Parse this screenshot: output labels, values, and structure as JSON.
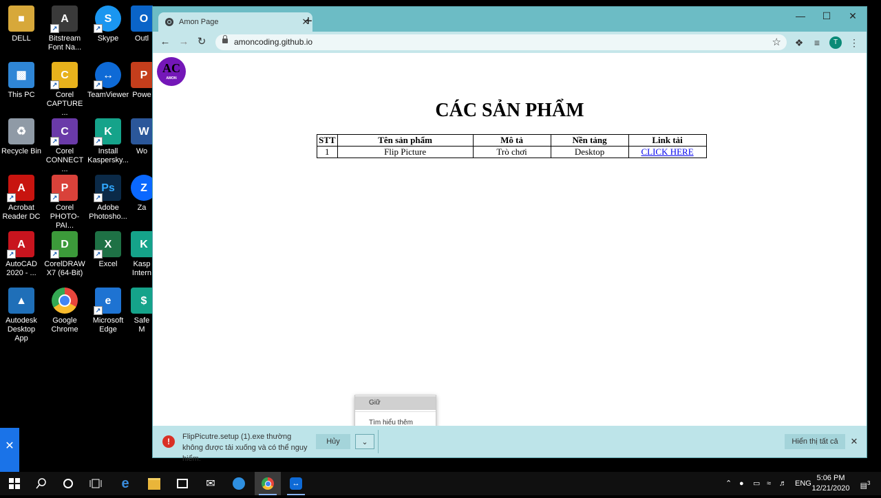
{
  "desktop": {
    "icons": [
      {
        "label": "DELL",
        "icon": "folder-user-icon",
        "color": "#d7a83a"
      },
      {
        "label": "Bitstream Font Na...",
        "icon": "bitstream-icon",
        "color": "#3a3a3a"
      },
      {
        "label": "Skype",
        "icon": "skype-icon",
        "color": "#1a96f0"
      },
      {
        "label": "Outl",
        "icon": "outlook-icon",
        "color": "#0a64c8"
      },
      {
        "label": "This PC",
        "icon": "computer-icon",
        "color": "#2f86d6"
      },
      {
        "label": "Corel CAPTURE ...",
        "icon": "corel-capture-icon",
        "color": "#e8b21c"
      },
      {
        "label": "TeamViewer",
        "icon": "teamviewer-icon",
        "color": "#0e6ad6"
      },
      {
        "label": "Powe",
        "icon": "powerpoint-icon",
        "color": "#c43e1c"
      },
      {
        "label": "Recycle Bin",
        "icon": "recycle-bin-icon",
        "color": "#8f9aa6"
      },
      {
        "label": "Corel CONNECT ...",
        "icon": "corel-connect-icon",
        "color": "#6a3aa8"
      },
      {
        "label": "Install Kaspersky...",
        "icon": "kaspersky-icon",
        "color": "#15a38a"
      },
      {
        "label": "Wo",
        "icon": "word-icon",
        "color": "#2b579a"
      },
      {
        "label": "Acrobat Reader DC",
        "icon": "acrobat-icon",
        "color": "#c8140f"
      },
      {
        "label": "Corel PHOTO-PAI...",
        "icon": "corel-photopaint-icon",
        "color": "#d9423a"
      },
      {
        "label": "Adobe Photosho...",
        "icon": "photoshop-icon",
        "color": "#0b2a48"
      },
      {
        "label": "Za",
        "icon": "zalo-icon",
        "color": "#0a68ff"
      },
      {
        "label": "AutoCAD 2020 - ...",
        "icon": "autocad-icon",
        "color": "#c8141e"
      },
      {
        "label": "CorelDRAW X7 (64-Bit)",
        "icon": "coreldraw-icon",
        "color": "#3c9a3a"
      },
      {
        "label": "Excel",
        "icon": "excel-icon",
        "color": "#1e7145"
      },
      {
        "label": "Kasp Intern",
        "icon": "kaspersky-internet-icon",
        "color": "#15a38a"
      },
      {
        "label": "Autodesk Desktop App",
        "icon": "autodesk-icon",
        "color": "#1f6fb8"
      },
      {
        "label": "Google Chrome",
        "icon": "chrome-icon",
        "color": "#e8453c"
      },
      {
        "label": "Microsoft Edge",
        "icon": "edge-icon",
        "color": "#1e73d2"
      },
      {
        "label": "Safe M",
        "icon": "safe-money-icon",
        "color": "#15a38a"
      }
    ]
  },
  "browser": {
    "tab_title": "Amon Page",
    "url": "amoncoding.github.io",
    "profile_initial": "T",
    "accent": "#6cbcc5"
  },
  "page": {
    "logo_text": "AC",
    "logo_small": "AMON",
    "heading": "CÁC SẢN PHẨM",
    "table": {
      "headers": [
        "STT",
        "Tên sản phẩm",
        "Mô tả",
        "Nền tảng",
        "Link tải"
      ],
      "rows": [
        [
          "1",
          "Flip Picture",
          "Trò chơi",
          "Desktop",
          "CLICK HERE"
        ]
      ]
    }
  },
  "context_menu": {
    "items": [
      "Giữ",
      "Tìm hiểu thêm"
    ]
  },
  "download_shelf": {
    "message": "FlipPicutre.setup (1).exe thường không được tải xuống và có thể nguy hiểm.",
    "cancel_label": "Hủy",
    "show_all_label": "Hiển thị tất cả",
    "warning_color": "#d93025"
  },
  "taskbar": {
    "language": "ENG",
    "time": "5:06 PM",
    "date": "12/21/2020",
    "notification_count": "3"
  }
}
